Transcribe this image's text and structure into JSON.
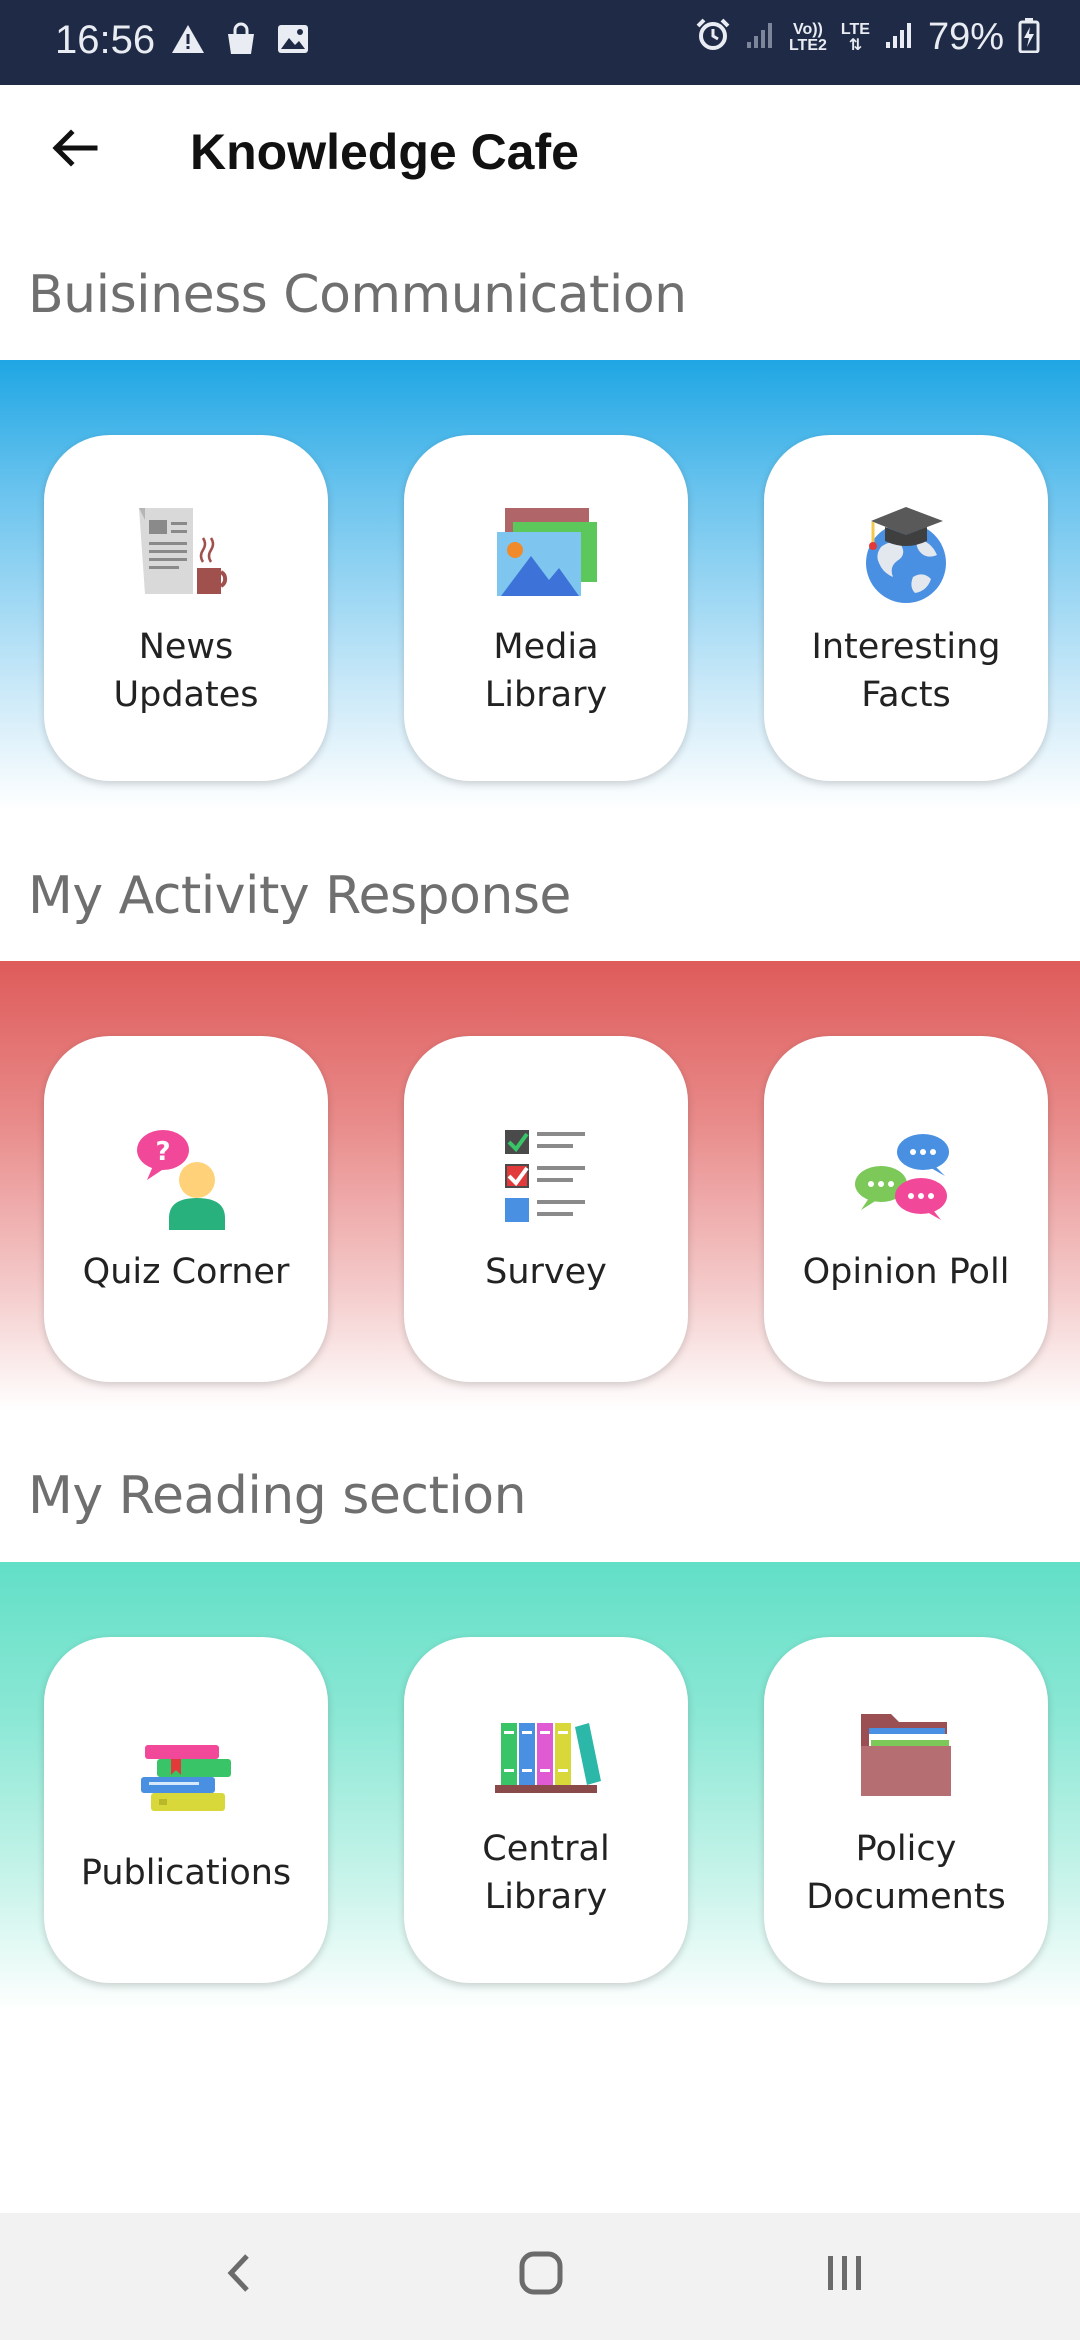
{
  "status_bar": {
    "time": "16:56",
    "battery": "79%",
    "network_top": "Vo))",
    "network_bottom": "LTE2",
    "lte_label": "LTE",
    "icons": [
      "warning-icon",
      "shopping-bag-icon",
      "image-icon",
      "alarm-icon",
      "signal-icon",
      "battery-charging-icon"
    ]
  },
  "header": {
    "title": "Knowledge Cafe",
    "back_icon": "arrow-left-icon"
  },
  "sections": [
    {
      "title": "Buisiness Communication",
      "accent": "#1fa6e4",
      "items": [
        {
          "label": "News\nUpdates",
          "icon": "newspaper-coffee-icon"
        },
        {
          "label": "Media\nLibrary",
          "icon": "image-gallery-icon"
        },
        {
          "label": "Interesting\nFacts",
          "icon": "globe-graduation-cap-icon"
        }
      ]
    },
    {
      "title": "My Activity Response",
      "accent": "#de5b5a",
      "items": [
        {
          "label": "Quiz Corner",
          "icon": "person-question-icon"
        },
        {
          "label": "Survey",
          "icon": "checklist-icon"
        },
        {
          "label": "Opinion Poll",
          "icon": "chat-bubbles-icon"
        }
      ]
    },
    {
      "title": "My Reading section",
      "accent": "#62dfc7",
      "items": [
        {
          "label": "Publications",
          "icon": "book-stack-icon"
        },
        {
          "label": "Central\nLibrary",
          "icon": "bookshelf-icon"
        },
        {
          "label": "Policy\nDocuments",
          "icon": "folder-documents-icon"
        }
      ]
    }
  ],
  "nav_bar": {
    "back": "chevron-left-icon",
    "home": "home-square-icon",
    "recents": "recents-lines-icon"
  }
}
